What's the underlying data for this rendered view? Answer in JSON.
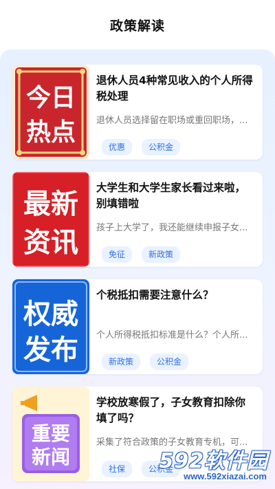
{
  "header": {
    "title": "政策解读"
  },
  "articles": [
    {
      "thumb_text": [
        "今日",
        "热点"
      ],
      "title": "退休人员4种常见收入的个人所得税处理",
      "summary": "退休人员选择留在职场或重回职场，...",
      "tags": [
        "优惠",
        "公积金"
      ]
    },
    {
      "thumb_text": [
        "最新",
        "资讯"
      ],
      "title": "大学生和大学生家长看过来啦，别填错啦",
      "summary": "孩子上大学了，我还能继续申报子女...",
      "tags": [
        "免征",
        "新政策"
      ]
    },
    {
      "thumb_text": [
        "权威",
        "发布"
      ],
      "title": "个税抵扣需要注意什么？",
      "summary": "个人所得税抵扣标准是什么？个人所...",
      "tags": [
        "新政策",
        "公积金"
      ]
    },
    {
      "thumb_text": [
        "重要",
        "新闻"
      ],
      "title": "学校放寒假了，子女教育扣除你填了吗？",
      "summary": "采集了符合政策的子女教育专机，可...",
      "tags": [
        "社保",
        "公积金"
      ]
    }
  ],
  "watermark": {
    "brand": "592软件园",
    "url": "www.592xiazai.com"
  }
}
